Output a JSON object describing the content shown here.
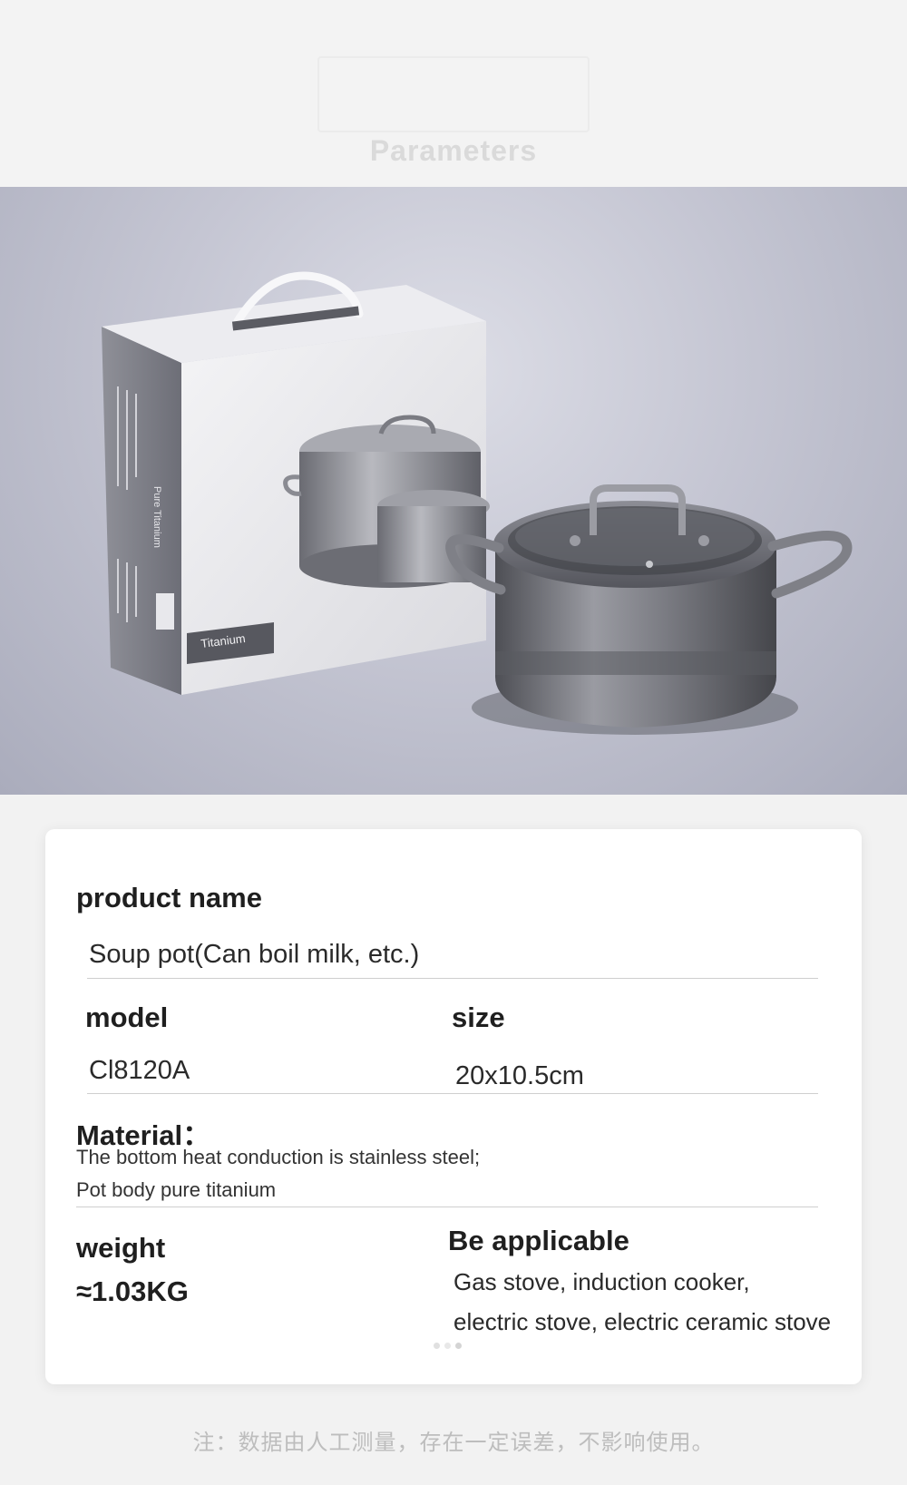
{
  "header": {
    "title": "Parameters"
  },
  "photo": {
    "box_label": "Titanium",
    "box_side_text": "Pure Titanium"
  },
  "card": {
    "product_name_label": "product name",
    "product_name_value": "Soup pot(Can boil milk, etc.)",
    "model_label": "model",
    "model_value": "Cl8120A",
    "size_label": "size",
    "size_value": "20x10.5cm",
    "material_label": "Material：",
    "material_line1": "The bottom heat conduction is stainless steel;",
    "material_line2": "Pot body pure titanium",
    "weight_label": "weight",
    "weight_value": "≈1.03KG",
    "applicable_label": "Be applicable",
    "applicable_line1": "Gas stove, induction cooker,",
    "applicable_line2": "electric stove, electric ceramic stove"
  },
  "footer": {
    "note": "注：数据由人工测量，存在一定误差，不影响使用。"
  },
  "colors": {
    "background": "#f2f2f2",
    "card": "#ffffff",
    "photo_backdrop": "#c5c6d3",
    "pot_metal": "#6e6f74"
  }
}
